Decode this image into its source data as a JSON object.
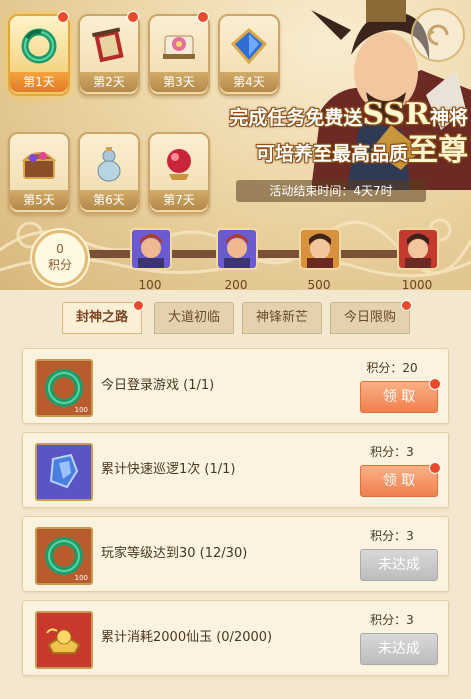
{
  "days": [
    {
      "label": "第1天",
      "icon": "jade-ring-icon",
      "active": true,
      "dot": true
    },
    {
      "label": "第2天",
      "icon": "banner-scroll-icon",
      "active": false,
      "dot": true
    },
    {
      "label": "第3天",
      "icon": "flower-scroll-icon",
      "active": false,
      "dot": true
    },
    {
      "label": "第4天",
      "icon": "blue-crystal-icon",
      "active": false,
      "dot": false
    },
    {
      "label": "第5天",
      "icon": "treasure-chest-icon",
      "active": false,
      "dot": false
    },
    {
      "label": "第6天",
      "icon": "gourd-bottle-icon",
      "active": false,
      "dot": false
    },
    {
      "label": "第7天",
      "icon": "red-orb-icon",
      "active": false,
      "dot": false
    }
  ],
  "headline": {
    "line1_prefix": "完成任务免费送",
    "line1_big": "SSR",
    "line1_suffix": "神将",
    "line2_prefix": "可培养至最高品质",
    "line2_big": "至尊"
  },
  "event_end": "活动结束时间：4天7时",
  "progress": {
    "score_value": "0",
    "score_label": "积分",
    "fill": 0,
    "milestones": [
      "100",
      "200",
      "500",
      "1000"
    ]
  },
  "tabs": [
    {
      "label": "封神之路",
      "active": true,
      "dot": true
    },
    {
      "label": "大道初临",
      "active": false,
      "dot": false
    },
    {
      "label": "神锋新芒",
      "active": false,
      "dot": false
    },
    {
      "label": "今日限购",
      "active": false,
      "dot": true
    }
  ],
  "tasks": [
    {
      "desc": "今日登录游戏 (1/1)",
      "score": "积分：20",
      "button": "领 取",
      "state": "claim",
      "dot": true,
      "icon": "jade-ring-icon",
      "qty": "100"
    },
    {
      "desc": "累计快速巡逻1次 (1/1)",
      "score": "积分：3",
      "button": "领 取",
      "state": "claim",
      "dot": true,
      "icon": "blue-crystal-shard-icon",
      "qty": ""
    },
    {
      "desc": "玩家等级达到30 (12/30)",
      "score": "积分：3",
      "button": "未达成",
      "state": "lock",
      "dot": false,
      "icon": "jade-ring-icon",
      "qty": "100"
    },
    {
      "desc": "累计消耗2000仙玉 (0/2000)",
      "score": "积分：3",
      "button": "未达成",
      "state": "lock",
      "dot": false,
      "icon": "gold-ingot-icon",
      "qty": ""
    }
  ],
  "colors": {
    "accent": "#f07f4e",
    "dot": "#e94b2d",
    "track": "#7a5037"
  }
}
